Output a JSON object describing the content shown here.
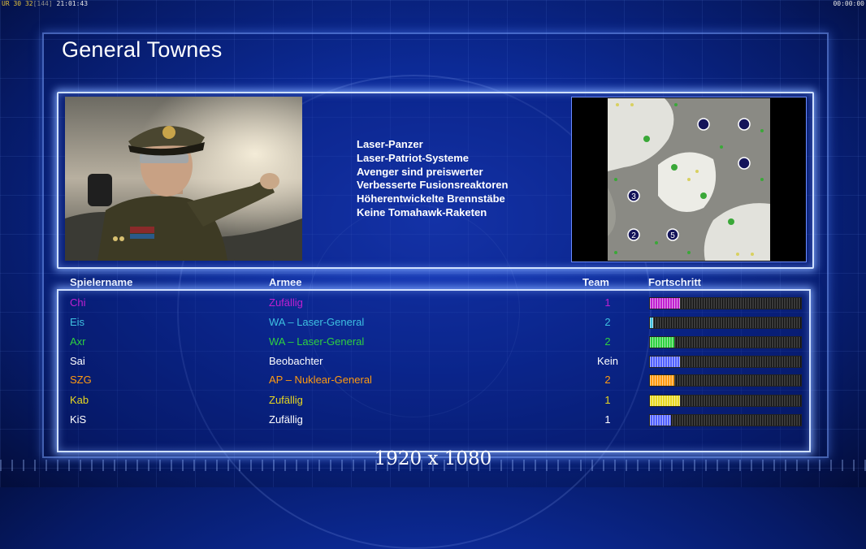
{
  "hud": {
    "top_left_fps": "30",
    "top_left_extra": "32",
    "top_left_bracket": "[144]",
    "top_left_clock": "21:01:43",
    "top_left_prefix": "UR",
    "top_right_timer": "00:00:00"
  },
  "general": {
    "title": "General Townes",
    "traits": [
      "Laser-Panzer",
      "Laser-Patriot-Systeme",
      "Avenger sind preiswerter",
      "Verbesserte Fusionsreaktoren",
      "Höherentwickelte Brennstäbe",
      "Keine Tomahawk-Raketen"
    ]
  },
  "minimap": {
    "start_labels": [
      "3",
      "2",
      "5"
    ]
  },
  "table": {
    "headers": {
      "player": "Spielername",
      "army": "Armee",
      "team": "Team",
      "progress": "Fortschritt"
    },
    "rows": [
      {
        "name": "Chi",
        "army": "Zufällig",
        "team": "1",
        "color": "#c020d0",
        "progress": 0.2
      },
      {
        "name": "Eis",
        "army": "WA – Laser-General",
        "team": "2",
        "color": "#3ec0e0",
        "progress": 0.02
      },
      {
        "name": "Axr",
        "army": "WA – Laser-General",
        "team": "2",
        "color": "#2ed040",
        "progress": 0.16
      },
      {
        "name": "Sai",
        "army": "Beobachter",
        "team": "Kein",
        "color": "#ffffff",
        "progress": 0.2
      },
      {
        "name": "SZG",
        "army": "AP – Nuklear-General",
        "team": "2",
        "color": "#ff9a10",
        "progress": 0.16
      },
      {
        "name": "Kab",
        "army": "Zufällig",
        "team": "1",
        "color": "#e8d820",
        "progress": 0.2
      },
      {
        "name": "KiS",
        "army": "Zufällig",
        "team": "1",
        "color": "#ffffff",
        "progress": 0.14
      }
    ]
  },
  "progress_colors": [
    "#c020d0",
    "#3ec0e0",
    "#2ed040",
    "#5060ff",
    "#ff9a10",
    "#e8d820",
    "#5060ff"
  ],
  "resolution_label": "1920 x 1080"
}
